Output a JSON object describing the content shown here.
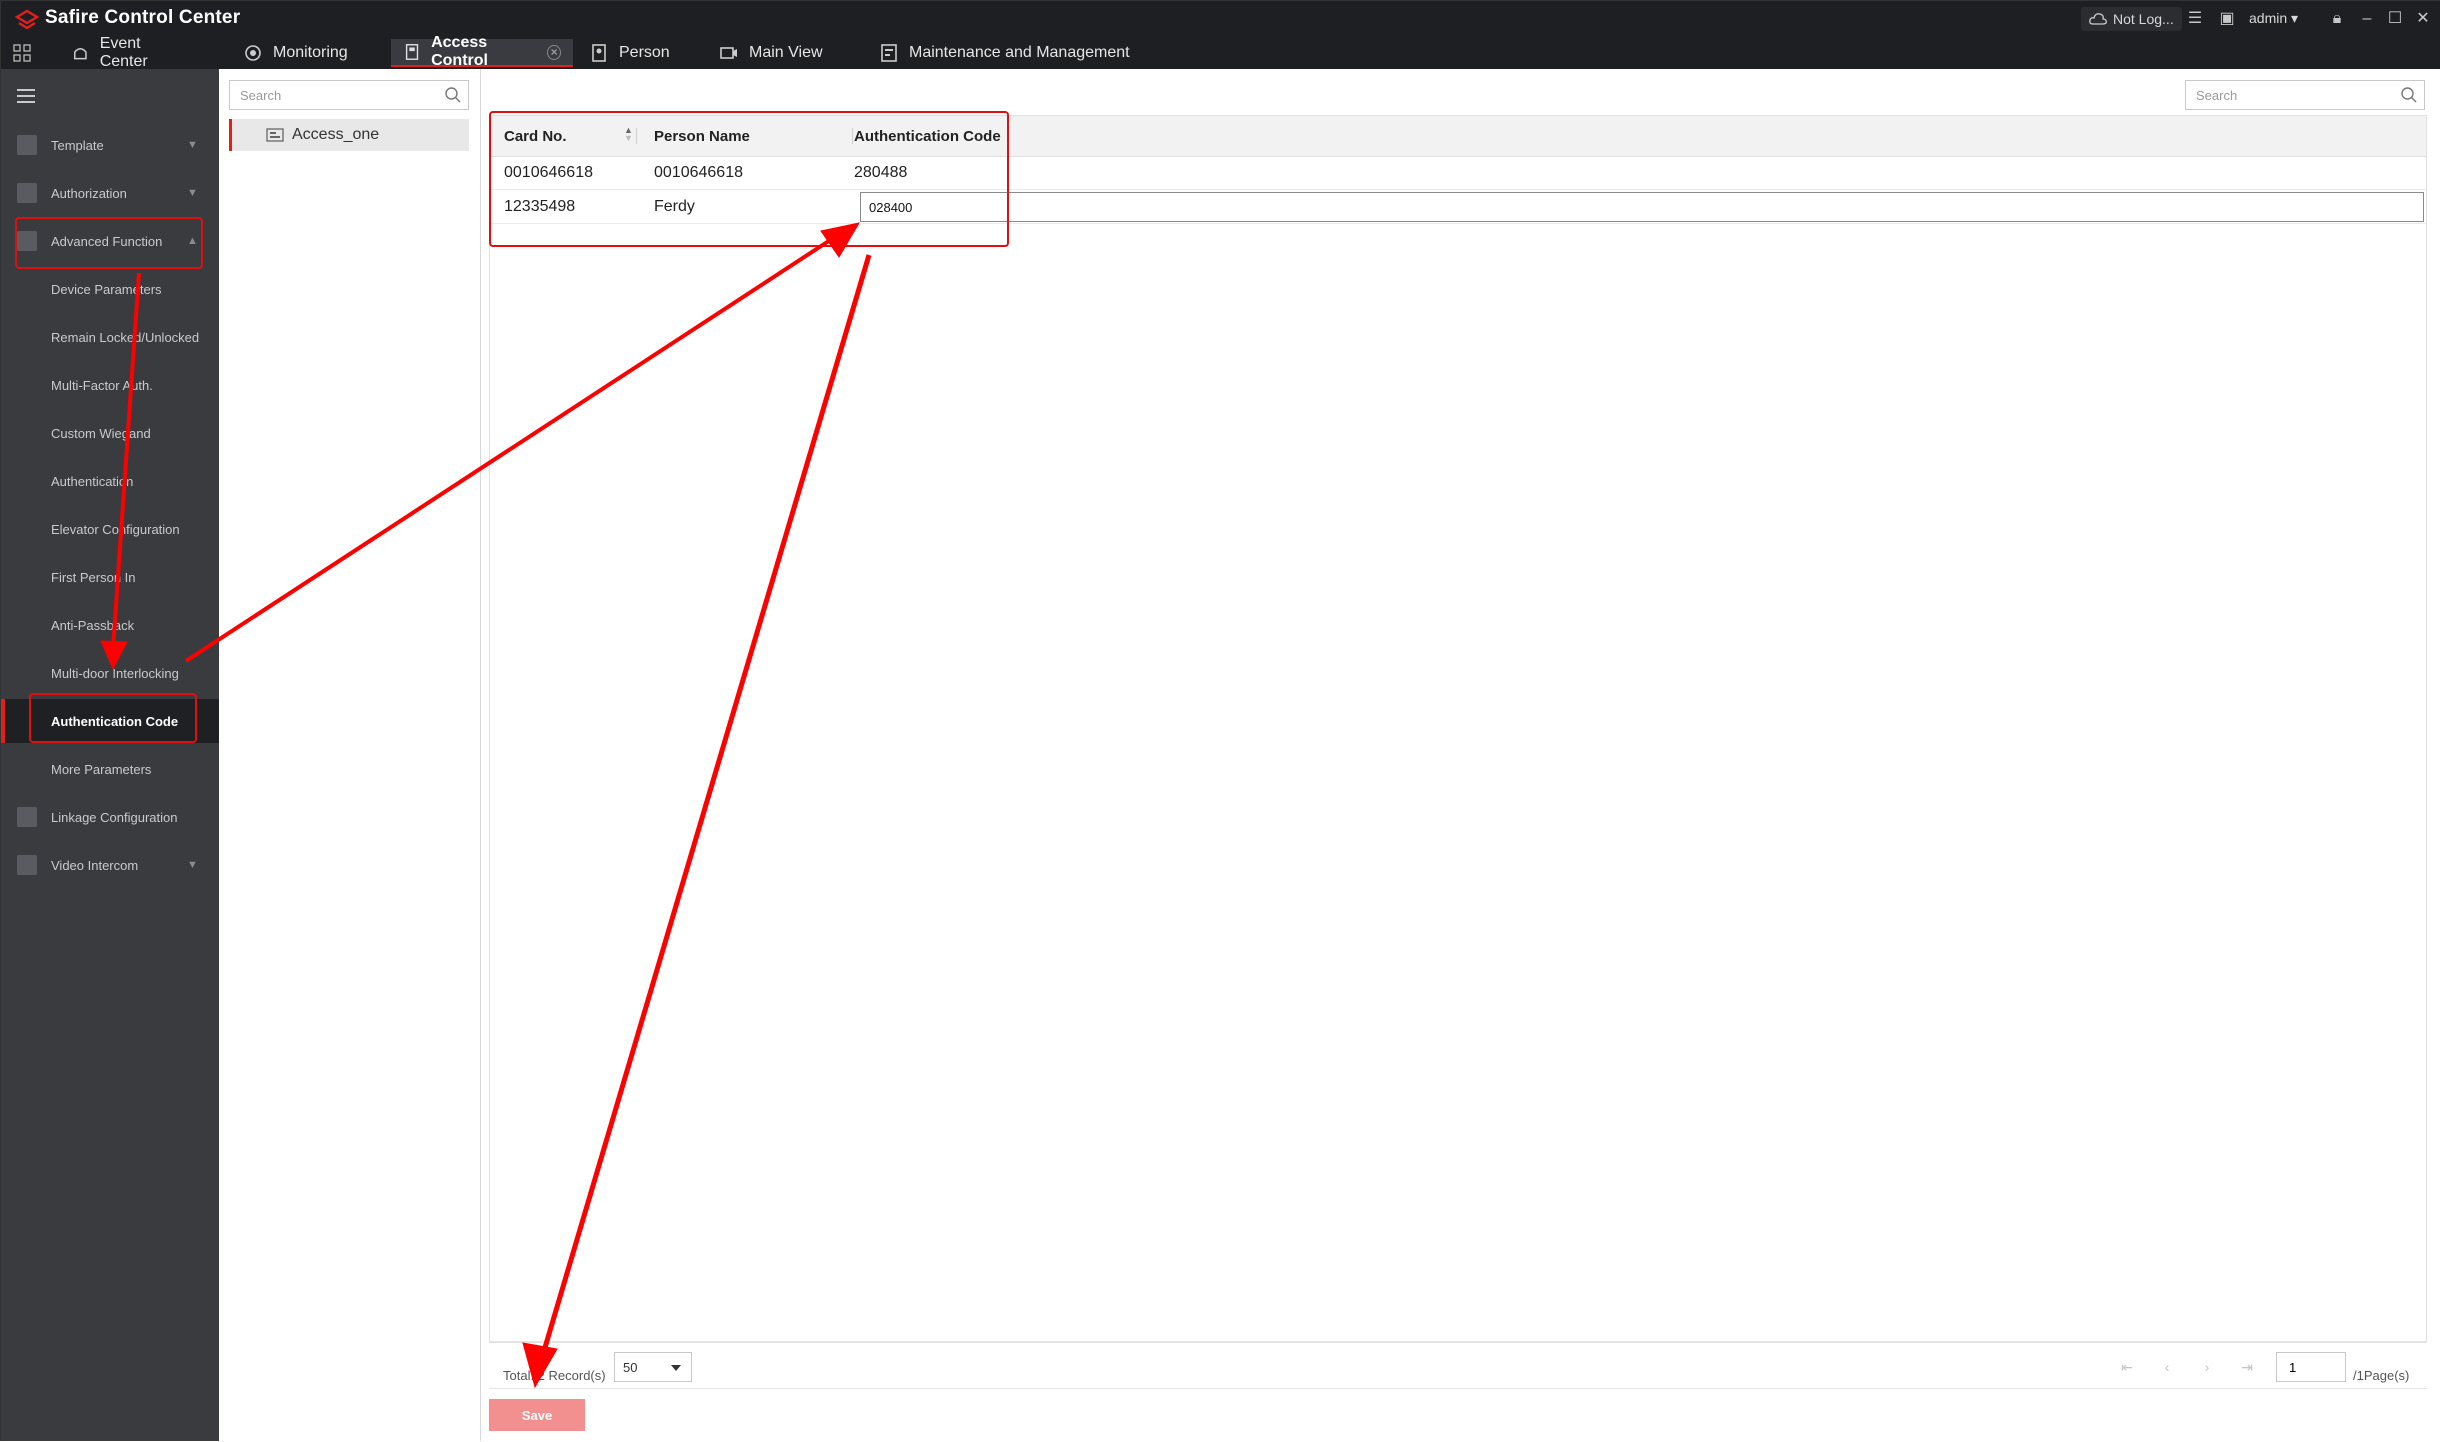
{
  "app": {
    "title": "Safire Control Center",
    "not_logged": "Not Log...",
    "user": "admin"
  },
  "tabs": [
    {
      "label": "Event Center",
      "icon": "event-center-icon"
    },
    {
      "label": "Monitoring",
      "icon": "camera-icon"
    },
    {
      "label": "Access Control",
      "icon": "access-control-icon",
      "active": true
    },
    {
      "label": "Person",
      "icon": "person-icon"
    },
    {
      "label": "Main View",
      "icon": "video-icon"
    },
    {
      "label": "Maintenance and Management",
      "icon": "maintenance-icon"
    }
  ],
  "sidebar": {
    "items": [
      {
        "label": "Template",
        "expandable": true
      },
      {
        "label": "Authorization",
        "expandable": true
      },
      {
        "label": "Advanced Function",
        "expanded": true
      }
    ],
    "subitems": [
      {
        "label": "Device Parameters"
      },
      {
        "label": "Remain Locked/Unlocked"
      },
      {
        "label": "Multi-Factor Auth."
      },
      {
        "label": "Custom Wiegand"
      },
      {
        "label": "Authentication"
      },
      {
        "label": "Elevator Configuration"
      },
      {
        "label": "First Person In"
      },
      {
        "label": "Anti-Passback"
      },
      {
        "label": "Multi-door Interlocking"
      },
      {
        "label": "Authentication Code",
        "active": true
      },
      {
        "label": "More Parameters"
      }
    ],
    "bottom_items": [
      {
        "label": "Linkage Configuration"
      },
      {
        "label": "Video Intercom",
        "expandable": true
      }
    ]
  },
  "device_panel": {
    "search_placeholder": "Search",
    "device": "Access_one"
  },
  "main": {
    "search_placeholder": "Search",
    "columns": [
      "Card No.",
      "Person Name",
      "Authentication Code"
    ],
    "rows": [
      {
        "card_no": "0010646618",
        "person_name": "0010646618",
        "auth_code": "280488"
      },
      {
        "card_no": "12335498",
        "person_name": "Ferdy",
        "auth_code": "028400"
      }
    ],
    "footer": {
      "total": "Total: 2 Record(s)",
      "page_size": "50",
      "page": "1",
      "pages": "/1Page(s)"
    },
    "save_label": "Save"
  },
  "colors": {
    "accent": "#e0201c",
    "titlebar": "#1e1f22",
    "sidebar": "#3a3b3f",
    "annotation": "#ff0000",
    "save_disabled": "#f28f8f"
  }
}
